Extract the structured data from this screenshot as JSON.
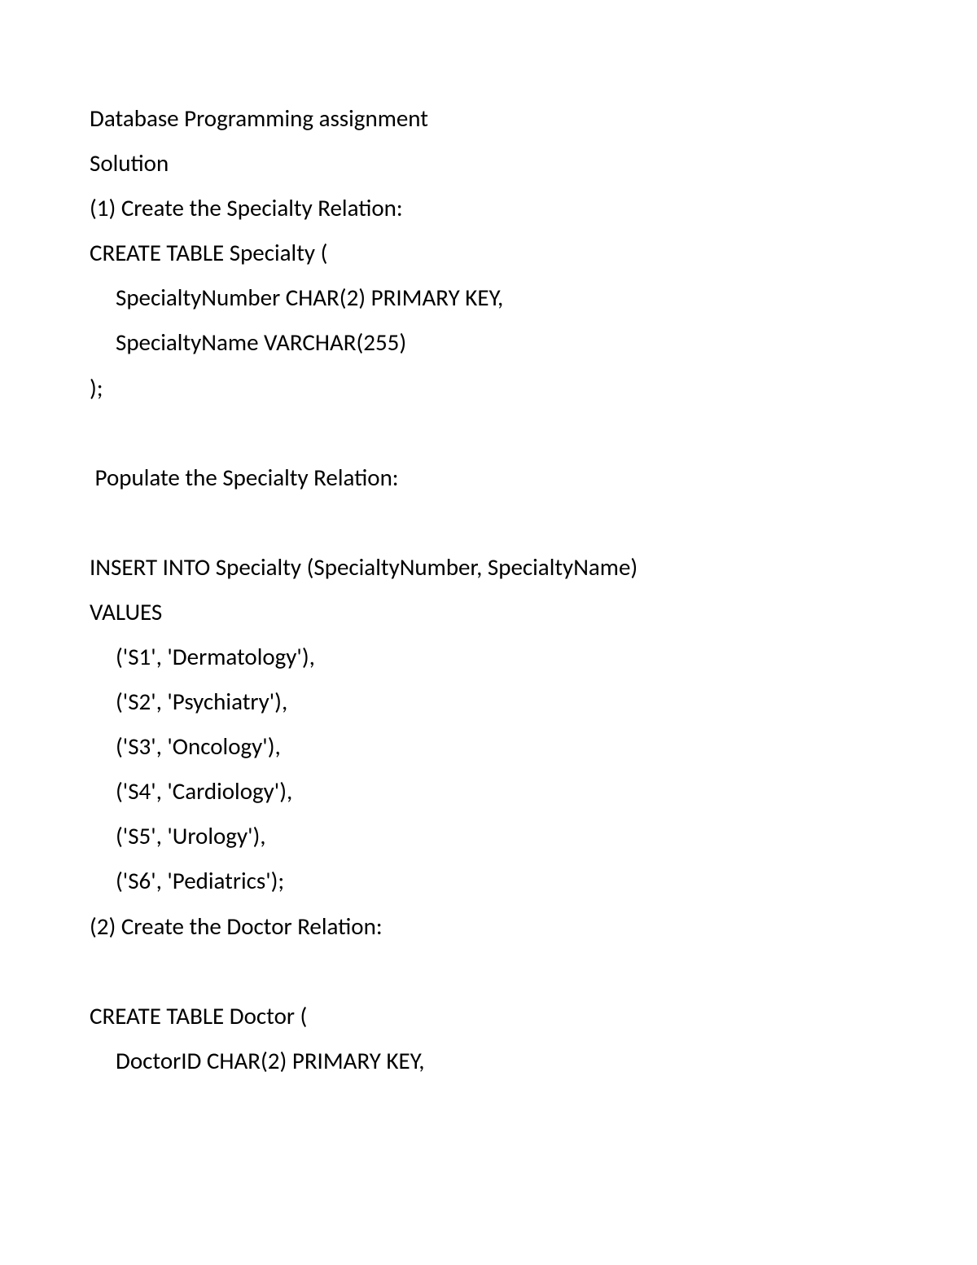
{
  "lines": [
    {
      "text": "Database Programming assignment",
      "indent": false
    },
    {
      "text": "Solution",
      "indent": false
    },
    {
      "text": "(1) Create the Specialty Relation:",
      "indent": false
    },
    {
      "text": "CREATE TABLE Specialty (",
      "indent": false
    },
    {
      "text": "SpecialtyNumber CHAR(2) PRIMARY KEY,",
      "indent": true
    },
    {
      "text": "SpecialtyName VARCHAR(255)",
      "indent": true
    },
    {
      "text": ");",
      "indent": false
    },
    {
      "text": "",
      "spacer": true
    },
    {
      "text": " Populate the Specialty Relation:",
      "indent": false,
      "smallIndent": true
    },
    {
      "text": "",
      "spacer": true
    },
    {
      "text": "INSERT INTO Specialty (SpecialtyNumber, SpecialtyName)",
      "indent": false
    },
    {
      "text": "VALUES",
      "indent": false
    },
    {
      "text": "('S1', 'Dermatology'),",
      "indent": true
    },
    {
      "text": "('S2', 'Psychiatry'),",
      "indent": true
    },
    {
      "text": "('S3', 'Oncology'),",
      "indent": true
    },
    {
      "text": "('S4', 'Cardiology'),",
      "indent": true
    },
    {
      "text": "('S5', 'Urology'),",
      "indent": true
    },
    {
      "text": "('S6', 'Pediatrics');",
      "indent": true
    },
    {
      "text": "(2) Create the Doctor Relation:",
      "indent": false
    },
    {
      "text": "",
      "spacer": true
    },
    {
      "text": "CREATE TABLE Doctor (",
      "indent": false
    },
    {
      "text": "DoctorID CHAR(2) PRIMARY KEY,",
      "indent": true
    }
  ]
}
